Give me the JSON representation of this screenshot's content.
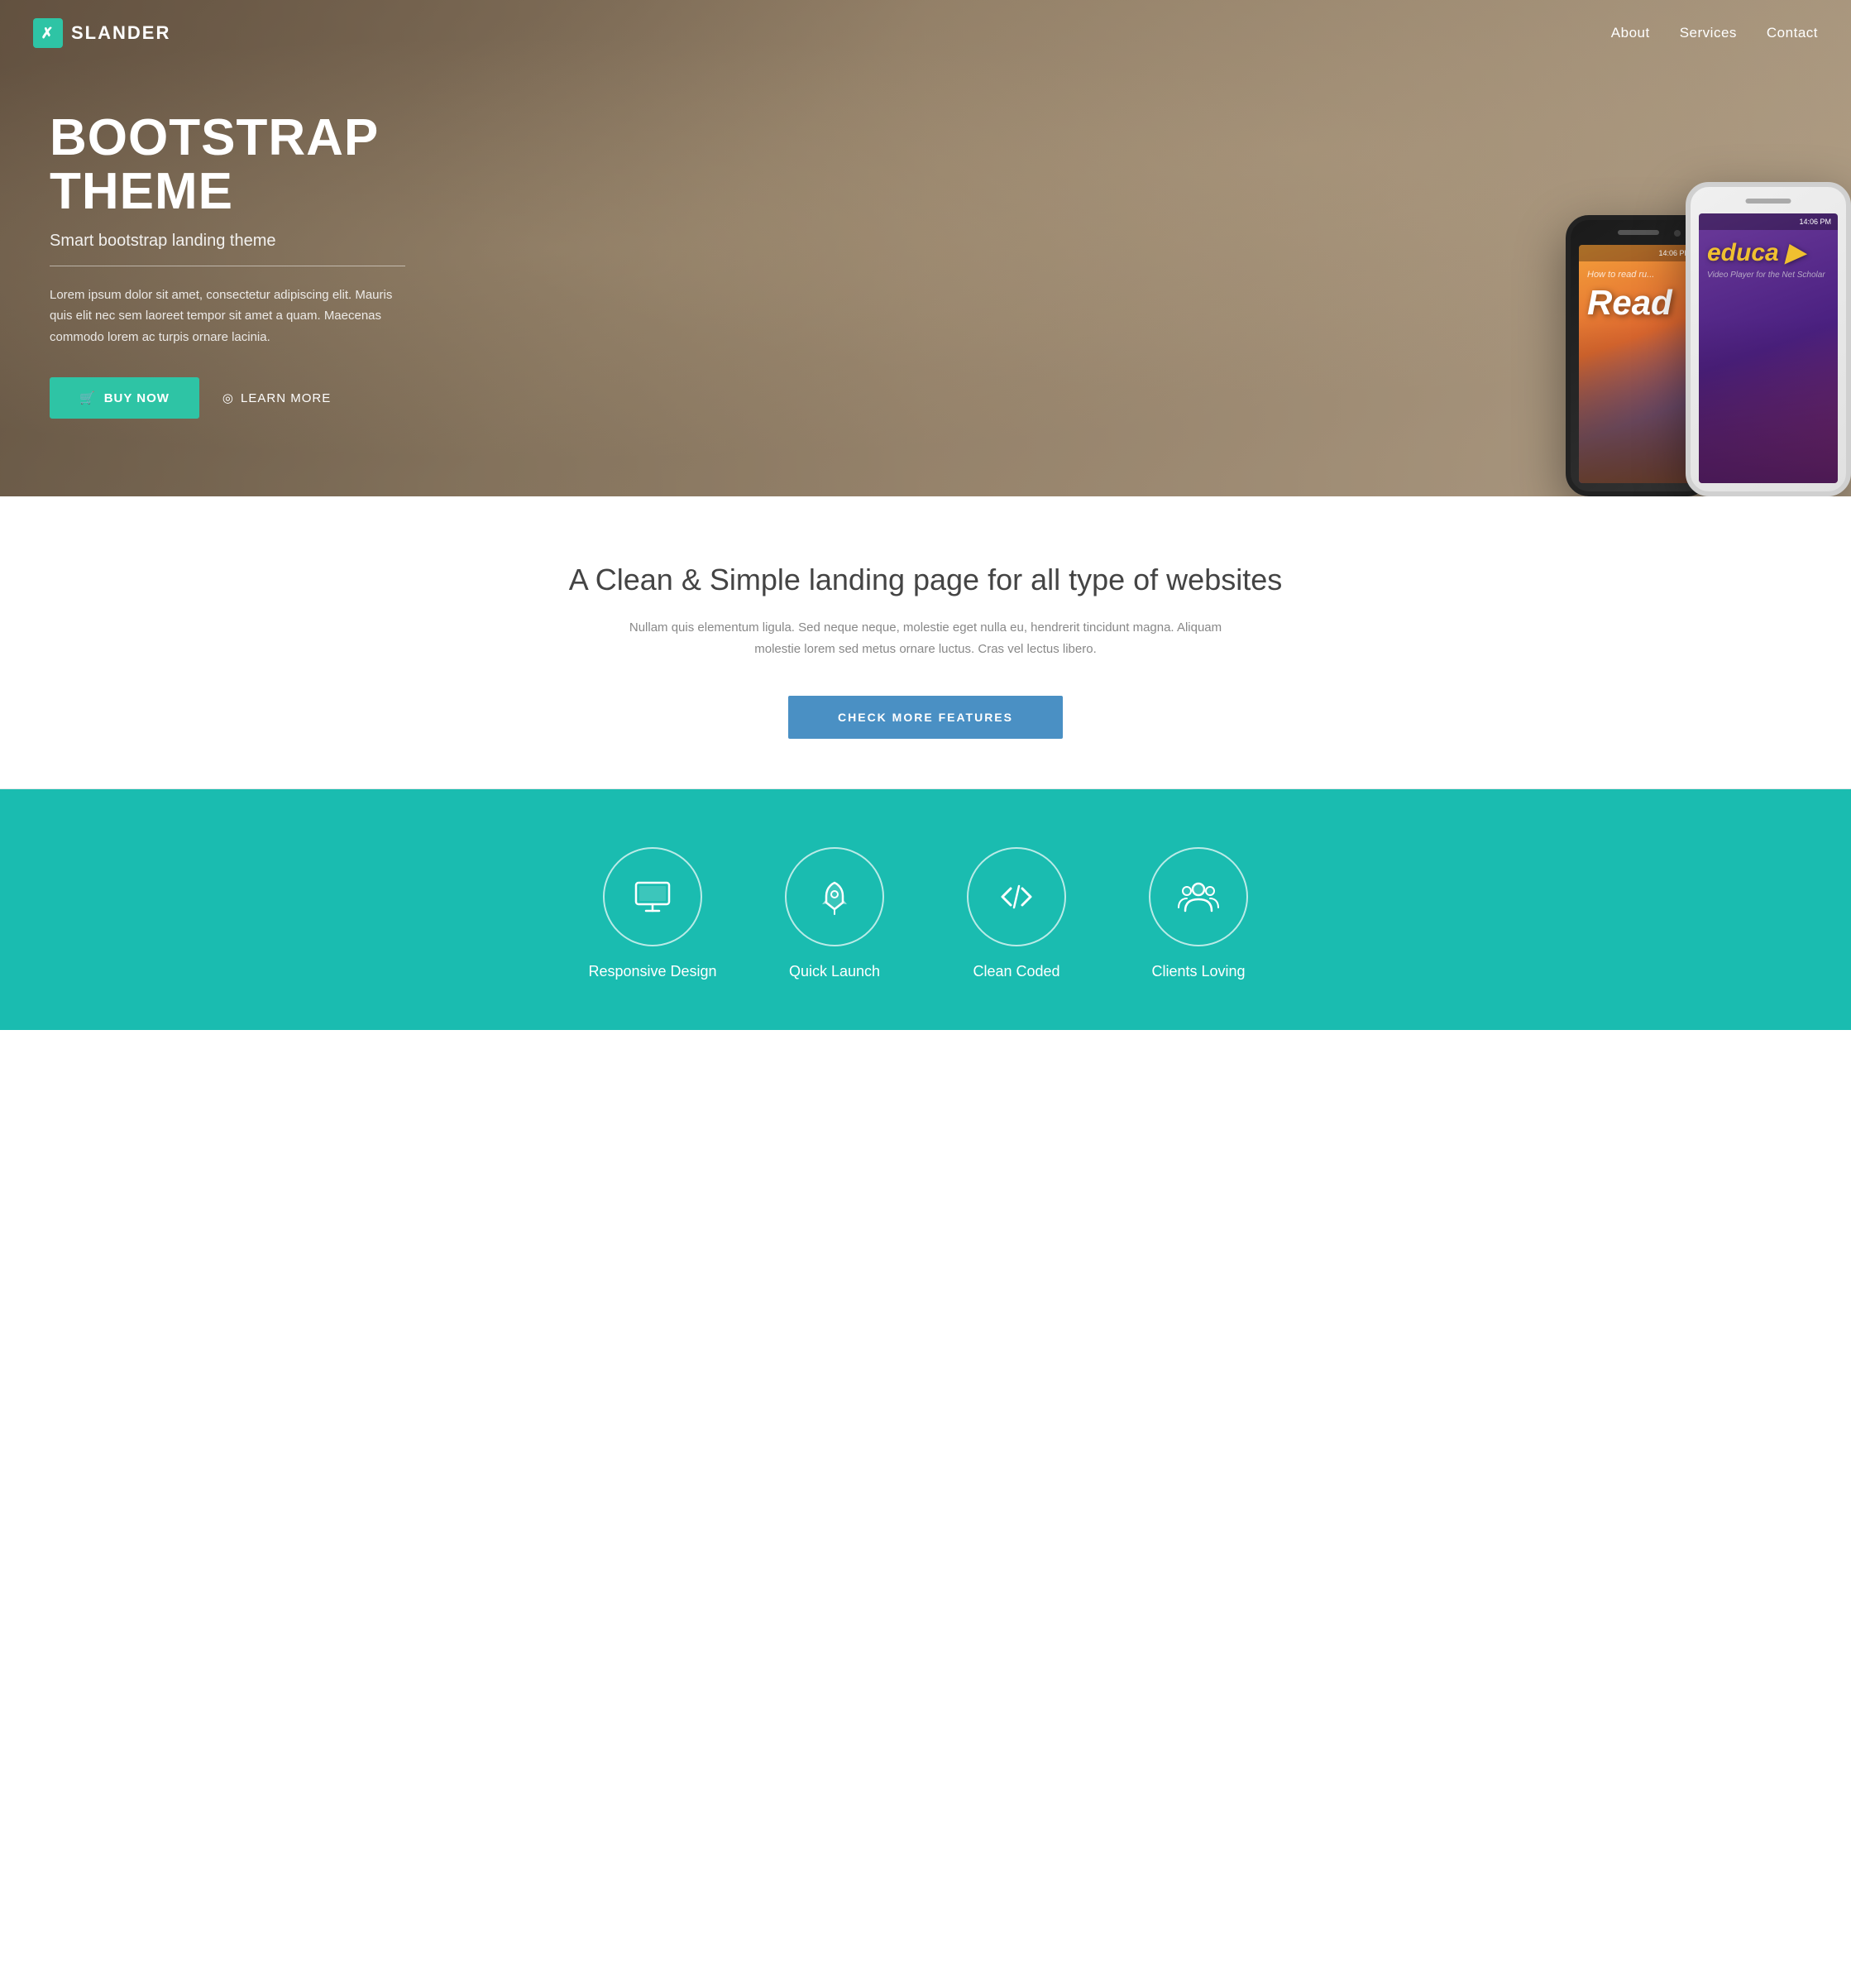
{
  "brand": {
    "logo_icon": "✗",
    "name": "SLANDER"
  },
  "nav": {
    "links": [
      {
        "label": "About",
        "href": "#about"
      },
      {
        "label": "Services",
        "href": "#services"
      },
      {
        "label": "Contact",
        "href": "#contact"
      }
    ]
  },
  "hero": {
    "title": "BOOTSTRAP THEME",
    "subtitle": "Smart bootstrap landing theme",
    "description": "Lorem ipsum dolor sit amet, consectetur adipiscing elit. Mauris quis elit nec sem laoreet tempor sit amet a quam. Maecenas commodo lorem ac turpis ornare lacinia.",
    "buy_label": "BUY NOW",
    "learn_label": "LEARN MORE",
    "phone_time": "14:06 PM"
  },
  "features": {
    "title": "A Clean & Simple landing page for all type of websites",
    "description": "Nullam quis elementum ligula. Sed neque neque, molestie eget nulla eu, hendrerit tincidunt magna. Aliquam molestie lorem sed metus ornare luctus. Cras vel lectus libero.",
    "button_label": "CHECK MORE FEATURES"
  },
  "services": {
    "items": [
      {
        "icon": "monitor",
        "label": "Responsive Design"
      },
      {
        "icon": "rocket",
        "label": "Quick Launch"
      },
      {
        "icon": "code",
        "label": "Clean Coded"
      },
      {
        "icon": "people",
        "label": "Clients Loving"
      }
    ]
  },
  "colors": {
    "teal": "#2ec4a5",
    "blue": "#4a90c4",
    "services_bg": "#1abcb0"
  }
}
